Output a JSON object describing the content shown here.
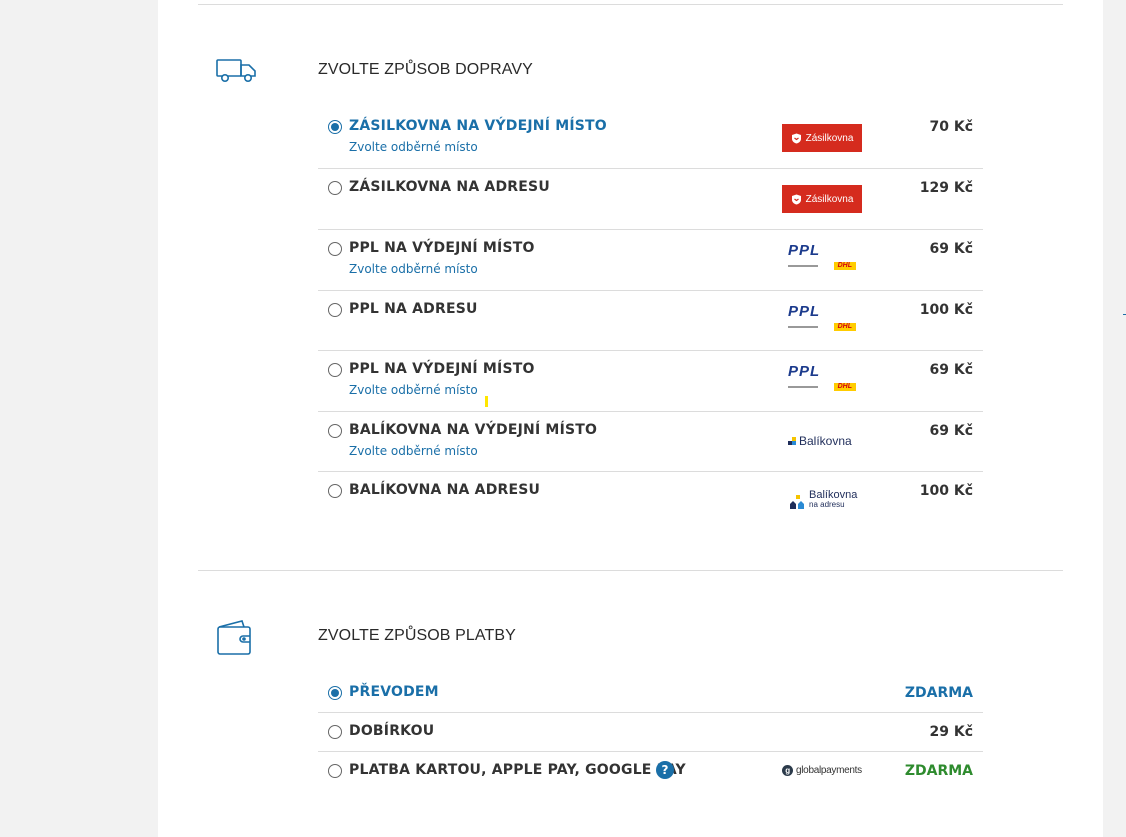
{
  "shipping": {
    "title": "ZVOLTE ZPŮSOB DOPRAVY",
    "icon": "truck-icon",
    "options": [
      {
        "name": "ZÁSILKOVNA NA VÝDEJNÍ MÍSTO",
        "sub": "Zvolte odběrné místo",
        "price": "70 Kč",
        "logo": "Zásilkovna",
        "selected": true
      },
      {
        "name": "ZÁSILKOVNA NA ADRESU",
        "sub": "",
        "price": "129 Kč",
        "logo": "Zásilkovna",
        "selected": false
      },
      {
        "name": "PPL NA VÝDEJNÍ MÍSTO",
        "sub": "Zvolte odběrné místo",
        "price": "69 Kč",
        "logo": "PPL",
        "logo_sub": "DHL",
        "selected": false
      },
      {
        "name": "PPL NA ADRESU",
        "sub": "",
        "price": "100 Kč",
        "logo": "PPL",
        "logo_sub": "DHL",
        "selected": false
      },
      {
        "name": "PPL NA VÝDEJNÍ MÍSTO",
        "sub": "Zvolte odběrné místo",
        "price": "69 Kč",
        "logo": "PPL",
        "logo_sub": "DHL",
        "selected": false
      },
      {
        "name": "BALÍKOVNA NA VÝDEJNÍ MÍSTO",
        "sub": "Zvolte odběrné místo",
        "price": "69 Kč",
        "logo": "Balíkovna",
        "selected": false
      },
      {
        "name": "BALÍKOVNA NA ADRESU",
        "sub": "",
        "price": "100 Kč",
        "logo": "Balíkovna",
        "logo_sub": "na adresu",
        "selected": false
      }
    ]
  },
  "payment": {
    "title": "ZVOLTE ZPŮSOB PLATBY",
    "icon": "wallet-icon",
    "options": [
      {
        "name": "PŘEVODEM",
        "price": "ZDARMA",
        "selected": true
      },
      {
        "name": "DOBÍRKOU",
        "price": "29 Kč",
        "selected": false
      },
      {
        "name": "PLATBA KARTOU, APPLE PAY, GOOGLE PAY",
        "price": "ZDARMA",
        "help": "?",
        "logo": "globalpayments",
        "logo_mark": "g",
        "selected": false
      }
    ]
  },
  "colors": {
    "accent": "#1a6fa8",
    "free_green": "#2e8b2e",
    "zasilkovna_red": "#d52b1e"
  }
}
